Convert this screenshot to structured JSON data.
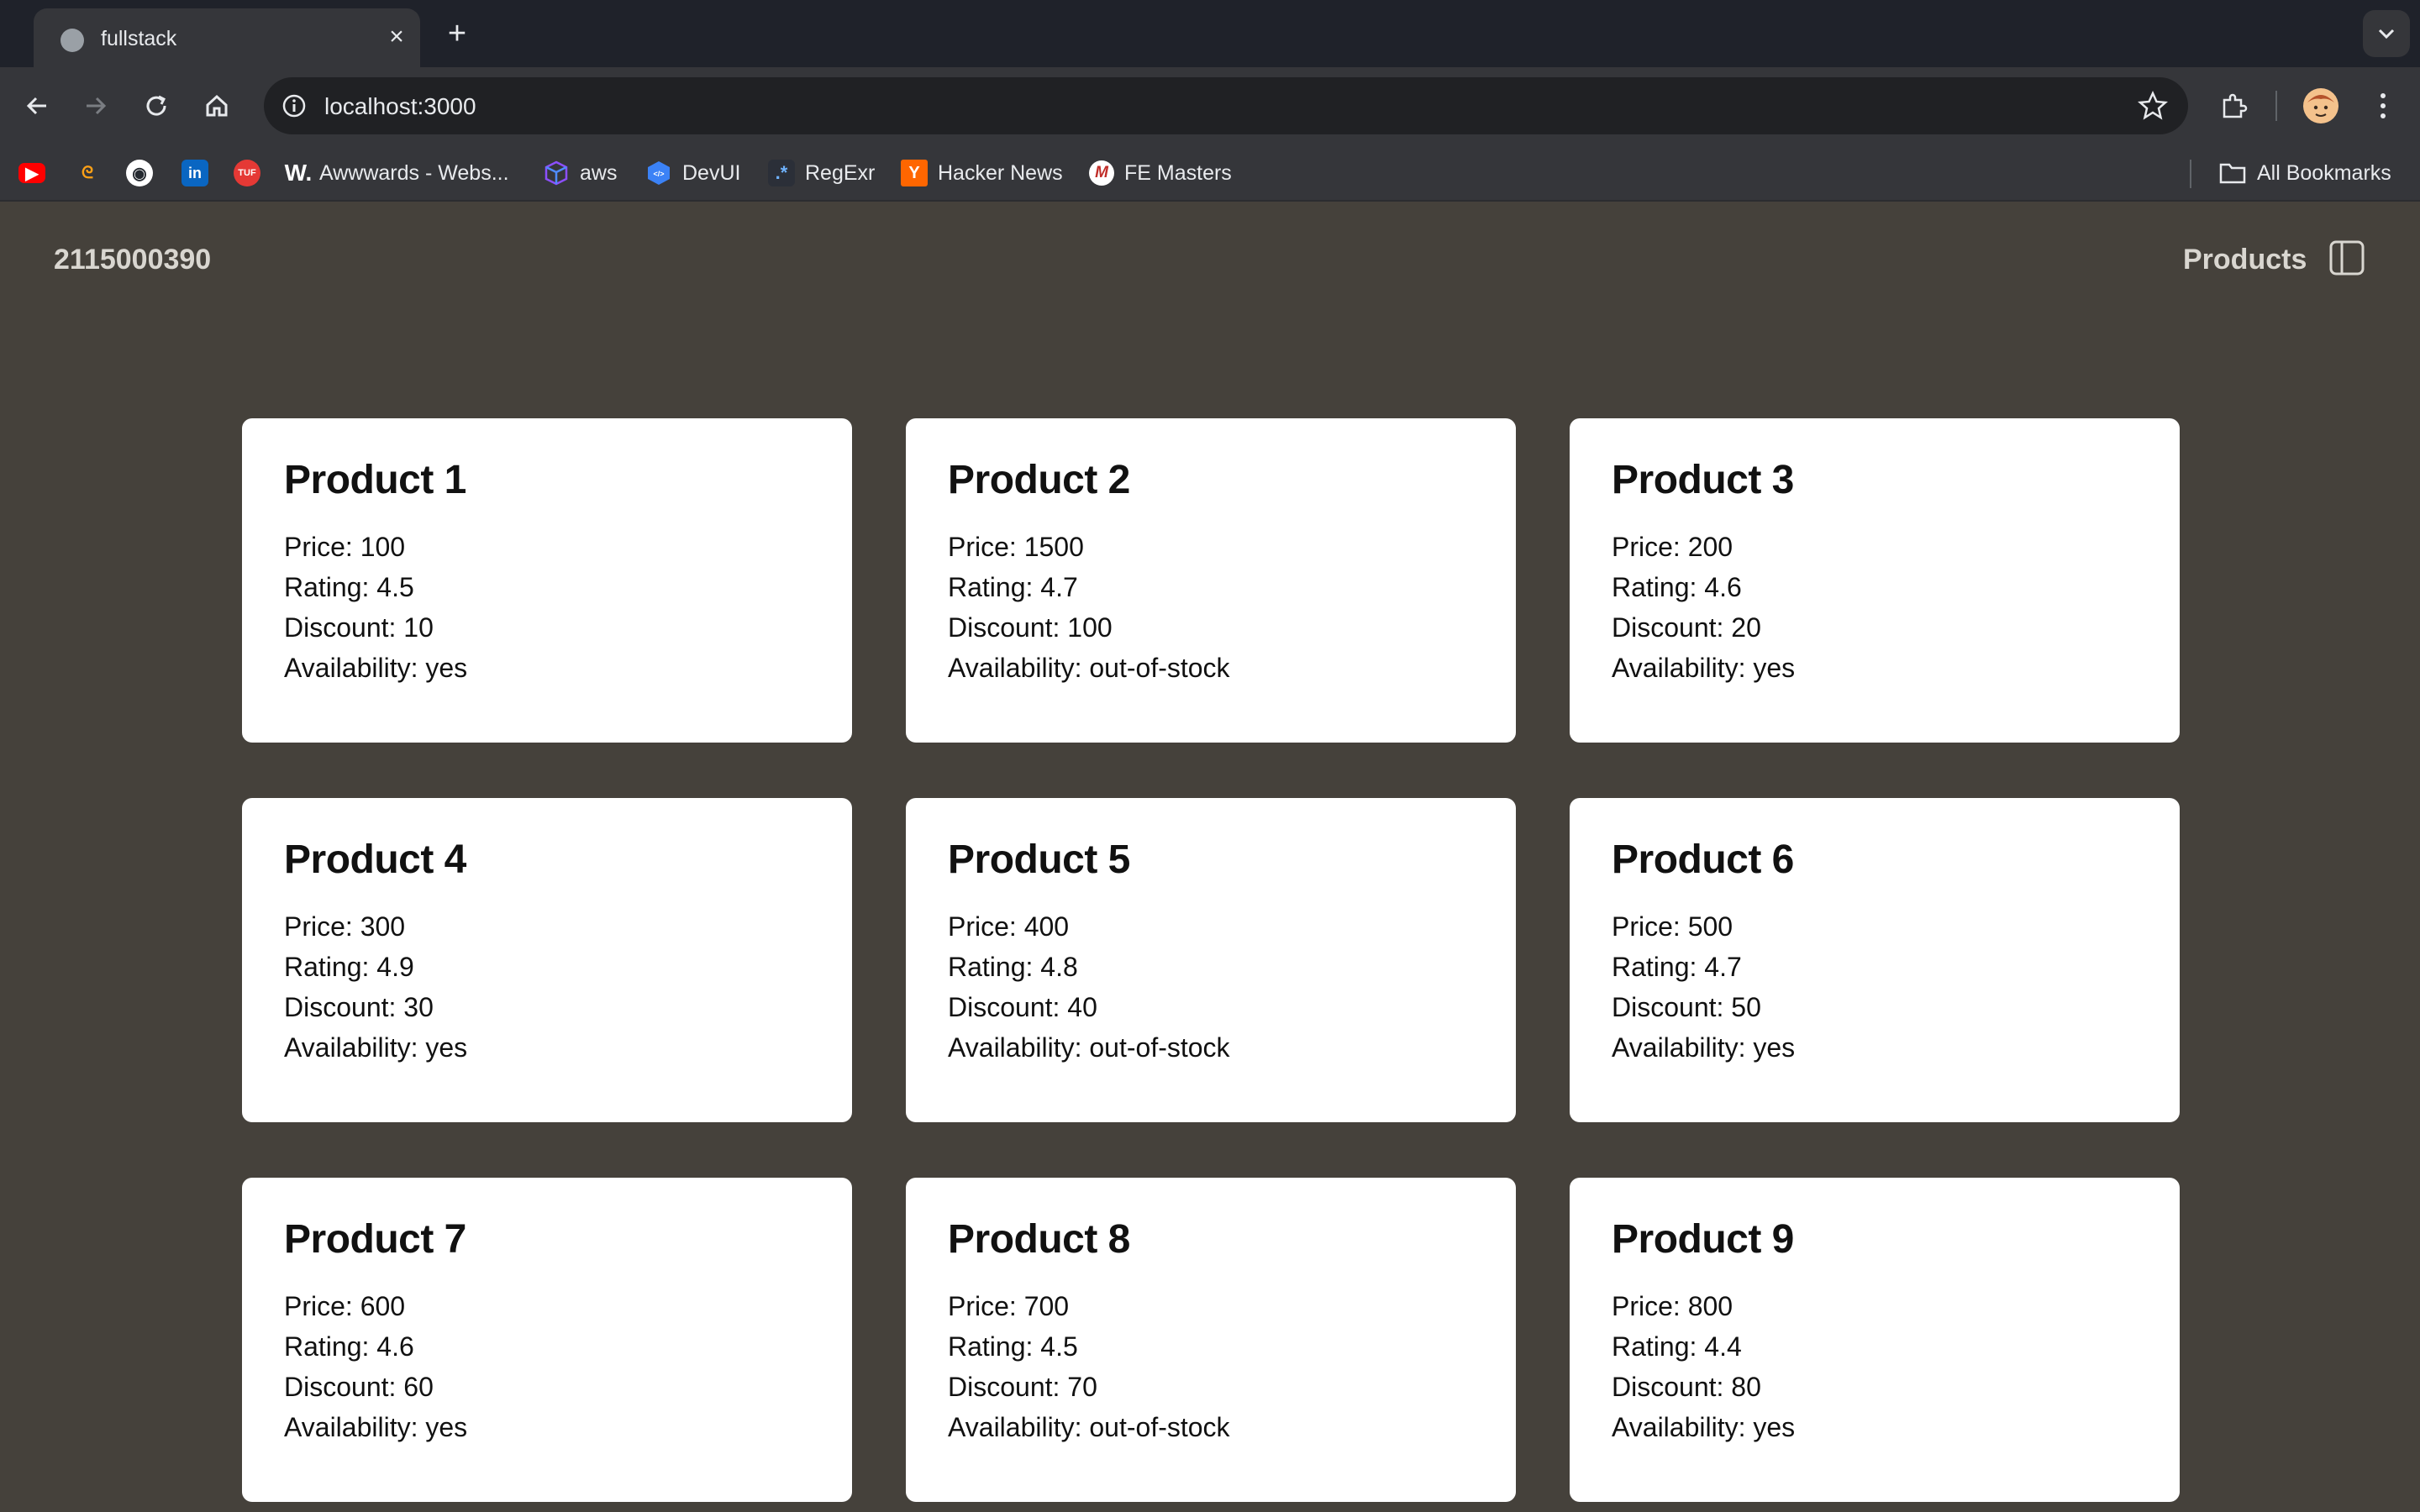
{
  "browser": {
    "tab_title": "fullstack",
    "url": "localhost:3000",
    "bookmarks": [
      {
        "label": "",
        "icon": "youtube-icon",
        "color": "#ff0000"
      },
      {
        "label": "",
        "icon": "leetcode-icon",
        "color": "#ffa116"
      },
      {
        "label": "",
        "icon": "github-icon",
        "color": "#ffffff"
      },
      {
        "label": "",
        "icon": "linkedin-icon",
        "color": "#0a66c2"
      },
      {
        "label": "",
        "icon": "tuf-icon",
        "color": "#e53935"
      },
      {
        "label": "Awwwards - Webs...",
        "icon": "awwwards-icon"
      },
      {
        "label": "aws",
        "icon": "aws-cube-icon",
        "color": "#8c4fff"
      },
      {
        "label": "DevUI",
        "icon": "devui-icon",
        "color": "#3b82f6"
      },
      {
        "label": "RegExr",
        "icon": "regexr-icon"
      },
      {
        "label": "Hacker News",
        "icon": "hacker-news-icon",
        "color": "#ff6600"
      },
      {
        "label": "FE Masters",
        "icon": "fe-masters-icon",
        "color": "#c02d28"
      }
    ],
    "all_bookmarks_label": "All Bookmarks"
  },
  "header": {
    "site_title": "2115000390",
    "nav_link": "Products"
  },
  "products": [
    {
      "name": "Product 1",
      "price": "Price: 100",
      "rating": "Rating: 4.5",
      "discount": "Discount: 10",
      "availability": "Availability: yes"
    },
    {
      "name": "Product 2",
      "price": "Price: 1500",
      "rating": "Rating: 4.7",
      "discount": "Discount: 100",
      "availability": "Availability: out-of-stock"
    },
    {
      "name": "Product 3",
      "price": "Price: 200",
      "rating": "Rating: 4.6",
      "discount": "Discount: 20",
      "availability": "Availability: yes"
    },
    {
      "name": "Product 4",
      "price": "Price: 300",
      "rating": "Rating: 4.9",
      "discount": "Discount: 30",
      "availability": "Availability: yes"
    },
    {
      "name": "Product 5",
      "price": "Price: 400",
      "rating": "Rating: 4.8",
      "discount": "Discount: 40",
      "availability": "Availability: out-of-stock"
    },
    {
      "name": "Product 6",
      "price": "Price: 500",
      "rating": "Rating: 4.7",
      "discount": "Discount: 50",
      "availability": "Availability: yes"
    },
    {
      "name": "Product 7",
      "price": "Price: 600",
      "rating": "Rating: 4.6",
      "discount": "Discount: 60",
      "availability": "Availability: yes"
    },
    {
      "name": "Product 8",
      "price": "Price: 700",
      "rating": "Rating: 4.5",
      "discount": "Discount: 70",
      "availability": "Availability: out-of-stock"
    },
    {
      "name": "Product 9",
      "price": "Price: 800",
      "rating": "Rating: 4.4",
      "discount": "Discount: 80",
      "availability": "Availability: yes"
    }
  ]
}
